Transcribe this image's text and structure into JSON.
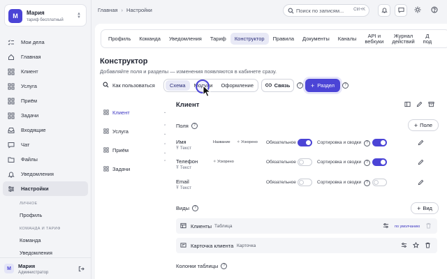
{
  "org": {
    "initial": "М",
    "name": "Мария",
    "plan": "тариф бесплатный"
  },
  "nav": {
    "items": [
      {
        "label": "Мои дела",
        "icon": "checklist-icon"
      },
      {
        "label": "Главная",
        "icon": "home-icon"
      },
      {
        "label": "Клиент",
        "icon": "grid-icon"
      },
      {
        "label": "Услуга",
        "icon": "grid-icon"
      },
      {
        "label": "Приём",
        "icon": "grid-icon"
      },
      {
        "label": "Задачи",
        "icon": "grid-icon"
      },
      {
        "label": "Входящие",
        "icon": "inbox-icon"
      },
      {
        "label": "Чат",
        "icon": "chat-icon"
      },
      {
        "label": "Файлы",
        "icon": "folder-icon"
      },
      {
        "label": "Уведомления",
        "icon": "bell-icon"
      },
      {
        "label": "Настройки",
        "icon": "settings-icon"
      }
    ],
    "group_personal": "ЛИЧНОЕ",
    "profile": "Профиль",
    "group_team": "КОМАНДА И ТАРИФ",
    "team": "Команда",
    "notifications": "Уведомления"
  },
  "user": {
    "initial": "М",
    "name": "Мария",
    "role": "Администратор"
  },
  "breadcrumb": {
    "home": "Главная",
    "current": "Настройки"
  },
  "search": {
    "placeholder": "Поиск по записям...",
    "shortcut": "Ctrl+K"
  },
  "tabs": [
    "Профиль",
    "Команда",
    "Уведомления",
    "Тариф",
    "Конструктор",
    "Правила",
    "Документы",
    "Каналы"
  ],
  "tabs_two_line": [
    {
      "l1": "API и",
      "l2": "вебхуки"
    },
    {
      "l1": "Журнал",
      "l2": "действий"
    },
    {
      "l1": "Д",
      "l2": "под"
    }
  ],
  "page": {
    "title": "Конструктор",
    "subtitle": "Добавляйте поля и разделы — изменения появляются в кабинете сразу.",
    "howto": "Как пользоваться",
    "seg": [
      "Схема",
      "Модули",
      "Оформление"
    ],
    "link_btn": "Связь",
    "add_section": "Раздел"
  },
  "entities": [
    "Клиент",
    "Услуга",
    "Приём",
    "Задачи"
  ],
  "entity": {
    "title": "Клиент",
    "fields_label": "Поля",
    "add_field": "Поле",
    "fields": [
      {
        "name": "Имя",
        "type": "Текст",
        "tag_title": "Название",
        "tag_fast": "Ускорено",
        "required_label": "Обязательное",
        "required": true,
        "sort_label": "Сортировка и сводки",
        "sort": true
      },
      {
        "name": "Телефон",
        "type": "Текст",
        "tag_fast": "Ускорено",
        "required_label": "Обязательное",
        "required": false,
        "sort_label": "Сортировка и сводки",
        "sort": true
      },
      {
        "name": "Email",
        "type": "Текст",
        "required_label": "Обязательное",
        "required": false,
        "sort_label": "Сортировка и сводки",
        "sort": false
      }
    ],
    "views_label": "Виды",
    "add_view": "Вид",
    "views": [
      {
        "name": "Клиенты",
        "type": "Таблица",
        "badge": "по умолчанию"
      },
      {
        "name": "Карточка клиента",
        "type": "Карточка"
      }
    ],
    "columns_label": "Колонки таблицы"
  },
  "colors": {
    "accent": "#4b44d6"
  }
}
